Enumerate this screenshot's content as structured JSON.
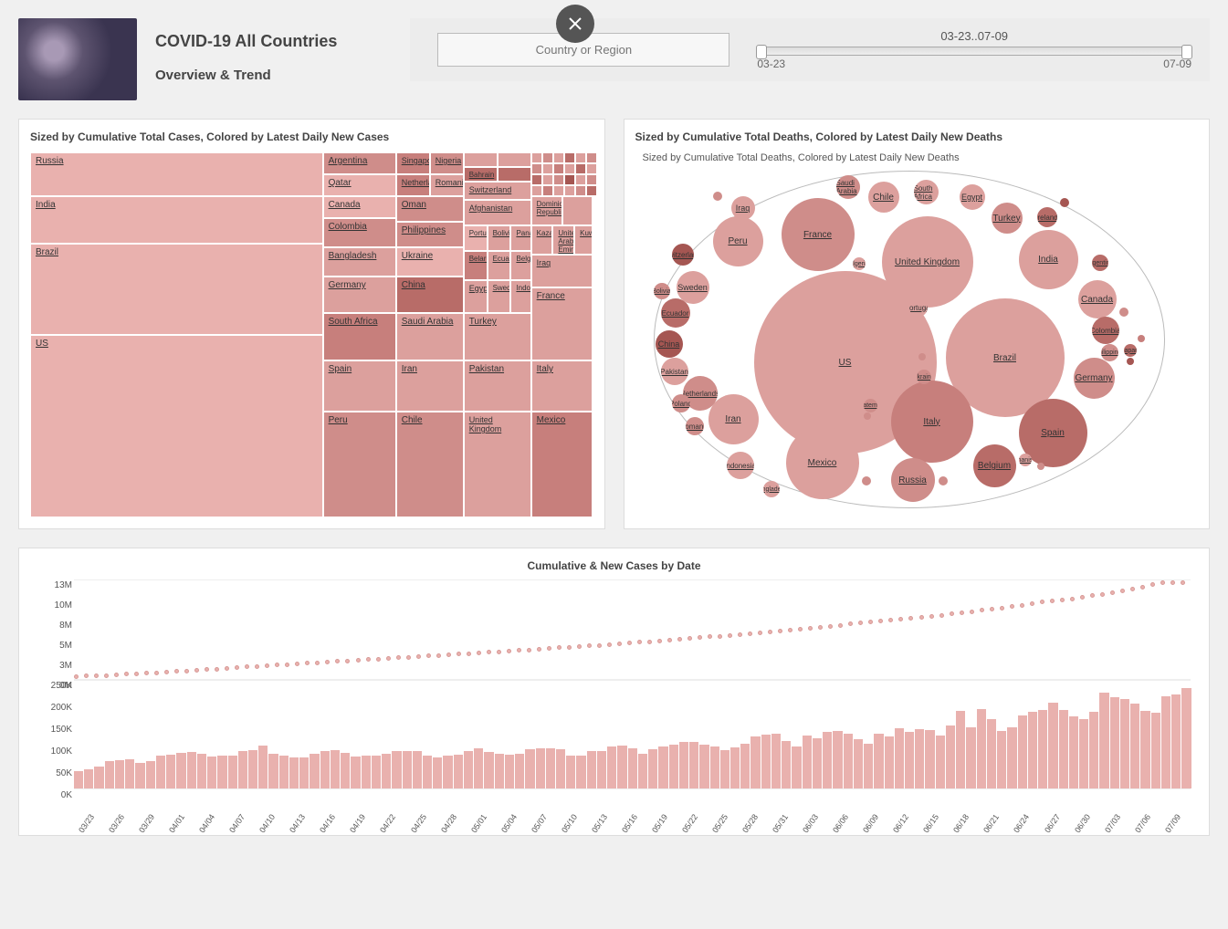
{
  "header": {
    "title": "COVID-19 All Countries",
    "subtitle": "Overview & Trend"
  },
  "filter": {
    "placeholder": "Country or Region",
    "range_label": "03-23..07-09",
    "range_start": "03-23",
    "range_end": "07-09"
  },
  "treemap_panel": {
    "title": "Sized by Cumulative Total Cases, Colored by Latest Daily New Cases"
  },
  "bubble_panel": {
    "title": "Sized by Cumulative Total Deaths, Colored by Latest Daily New Deaths",
    "subtitle": "Sized by Cumulative Total Deaths, Colored by Latest Daily New Deaths"
  },
  "bottom_panel": {
    "title": "Cumulative & New Cases by Date"
  },
  "chart_data": [
    {
      "type": "treemap",
      "title": "Sized by Cumulative Total Cases, Colored by Latest Daily New Cases",
      "items": [
        {
          "name": "US",
          "size": 3200000,
          "color": 1
        },
        {
          "name": "Brazil",
          "size": 1800000,
          "color": 1
        },
        {
          "name": "India",
          "size": 800000,
          "color": 1
        },
        {
          "name": "Russia",
          "size": 700000,
          "color": 1
        },
        {
          "name": "Peru",
          "size": 320000,
          "color": 3
        },
        {
          "name": "Spain",
          "size": 300000,
          "color": 2
        },
        {
          "name": "Chile",
          "size": 300000,
          "color": 3
        },
        {
          "name": "United Kingdom",
          "size": 290000,
          "color": 2
        },
        {
          "name": "Mexico",
          "size": 280000,
          "color": 4
        },
        {
          "name": "South Africa",
          "size": 250000,
          "color": 4
        },
        {
          "name": "Iran",
          "size": 250000,
          "color": 2
        },
        {
          "name": "Pakistan",
          "size": 240000,
          "color": 2
        },
        {
          "name": "Italy",
          "size": 240000,
          "color": 2
        },
        {
          "name": "Saudi Arabia",
          "size": 230000,
          "color": 2
        },
        {
          "name": "Turkey",
          "size": 210000,
          "color": 2
        },
        {
          "name": "France",
          "size": 210000,
          "color": 2
        },
        {
          "name": "Germany",
          "size": 200000,
          "color": 2
        },
        {
          "name": "Bangladesh",
          "size": 180000,
          "color": 2
        },
        {
          "name": "Colombia",
          "size": 140000,
          "color": 3
        },
        {
          "name": "Canada",
          "size": 110000,
          "color": 1
        },
        {
          "name": "Qatar",
          "size": 100000,
          "color": 1
        },
        {
          "name": "Argentina",
          "size": 90000,
          "color": 3
        },
        {
          "name": "China",
          "size": 85000,
          "color": 5
        },
        {
          "name": "Egypt",
          "size": 80000,
          "color": 2
        },
        {
          "name": "Sweden",
          "size": 75000,
          "color": 2
        },
        {
          "name": "Indonesia",
          "size": 70000,
          "color": 2
        },
        {
          "name": "Iraq",
          "size": 70000,
          "color": 2
        },
        {
          "name": "Belarus",
          "size": 65000,
          "color": 4
        },
        {
          "name": "Ecuador",
          "size": 65000,
          "color": 2
        },
        {
          "name": "Belgium",
          "size": 62000,
          "color": 2
        },
        {
          "name": "Kazakhstan",
          "size": 55000,
          "color": 2
        },
        {
          "name": "United Arab Emirates",
          "size": 54000,
          "color": 2
        },
        {
          "name": "Kuwait",
          "size": 53000,
          "color": 2
        },
        {
          "name": "Ukraine",
          "size": 52000,
          "color": 1
        },
        {
          "name": "Oman",
          "size": 51000,
          "color": 3
        },
        {
          "name": "Philippines",
          "size": 50000,
          "color": 3
        },
        {
          "name": "Portugal",
          "size": 45000,
          "color": 1
        },
        {
          "name": "Bolivia",
          "size": 44000,
          "color": 2
        },
        {
          "name": "Panama",
          "size": 42000,
          "color": 2
        },
        {
          "name": "Dominican Republic",
          "size": 41000,
          "color": 2
        },
        {
          "name": "Afghanistan",
          "size": 34000,
          "color": 2
        },
        {
          "name": "Switzerland",
          "size": 33000,
          "color": 2
        },
        {
          "name": "Netherlands",
          "size": 51000,
          "color": 4
        },
        {
          "name": "Singapore",
          "size": 45000,
          "color": 4
        },
        {
          "name": "Nigeria",
          "size": 31000,
          "color": 3
        },
        {
          "name": "Romania",
          "size": 31000,
          "color": 2
        },
        {
          "name": "Bahrain",
          "size": 31000,
          "color": 5
        }
      ]
    },
    {
      "type": "bubble",
      "title": "Sized by Cumulative Total Deaths, Colored by Latest Daily New Deaths",
      "items": [
        {
          "name": "US",
          "size": 135000,
          "color": 2
        },
        {
          "name": "Brazil",
          "size": 70000,
          "color": 2
        },
        {
          "name": "United Kingdom",
          "size": 45000,
          "color": 2
        },
        {
          "name": "Italy",
          "size": 35000,
          "color": 4
        },
        {
          "name": "Mexico",
          "size": 34000,
          "color": 2
        },
        {
          "name": "France",
          "size": 30000,
          "color": 3
        },
        {
          "name": "Spain",
          "size": 28000,
          "color": 5
        },
        {
          "name": "India",
          "size": 22000,
          "color": 2
        },
        {
          "name": "Iran",
          "size": 13000,
          "color": 2
        },
        {
          "name": "Peru",
          "size": 12000,
          "color": 2
        },
        {
          "name": "Russia",
          "size": 11000,
          "color": 3
        },
        {
          "name": "Belgium",
          "size": 10000,
          "color": 5
        },
        {
          "name": "Germany",
          "size": 9000,
          "color": 3
        },
        {
          "name": "Canada",
          "size": 8800,
          "color": 2
        },
        {
          "name": "Netherlands",
          "size": 6100,
          "color": 3
        },
        {
          "name": "Chile",
          "size": 7000,
          "color": 2
        },
        {
          "name": "Sweden",
          "size": 5500,
          "color": 2
        },
        {
          "name": "Turkey",
          "size": 5300,
          "color": 3
        },
        {
          "name": "Ecuador",
          "size": 5000,
          "color": 5
        },
        {
          "name": "China",
          "size": 4600,
          "color": 6
        },
        {
          "name": "Colombia",
          "size": 4600,
          "color": 5
        },
        {
          "name": "Indonesia",
          "size": 3500,
          "color": 2
        },
        {
          "name": "Pakistan",
          "size": 5000,
          "color": 2
        },
        {
          "name": "Egypt",
          "size": 3900,
          "color": 2
        },
        {
          "name": "South Africa",
          "size": 3700,
          "color": 2
        },
        {
          "name": "Iraq",
          "size": 3000,
          "color": 2
        },
        {
          "name": "Saudi Arabia",
          "size": 2000,
          "color": 3
        },
        {
          "name": "Switzerland",
          "size": 1900,
          "color": 6
        },
        {
          "name": "Ireland",
          "size": 1700,
          "color": 5
        },
        {
          "name": "Portugal",
          "size": 1600,
          "color": 2
        },
        {
          "name": "Poland",
          "size": 1500,
          "color": 3
        },
        {
          "name": "Romania",
          "size": 1800,
          "color": 3
        },
        {
          "name": "Philippines",
          "size": 1300,
          "color": 3
        },
        {
          "name": "Argentina",
          "size": 1700,
          "color": 5
        },
        {
          "name": "Bolivia",
          "size": 1500,
          "color": 3
        },
        {
          "name": "Ukraine",
          "size": 1300,
          "color": 3
        },
        {
          "name": "Bangladesh",
          "size": 2300,
          "color": 2
        },
        {
          "name": "Guatemala",
          "size": 1100,
          "color": 3
        },
        {
          "name": "Algeria",
          "size": 1000,
          "color": 2
        },
        {
          "name": "Afghanistan",
          "size": 1000,
          "color": 2
        },
        {
          "name": "Japan",
          "size": 980,
          "color": 5
        }
      ]
    },
    {
      "type": "line",
      "title": "Cumulative Cases",
      "xlabel": "",
      "ylabel": "",
      "ylim": [
        0,
        13000000
      ],
      "y_ticks": [
        "0M",
        "3M",
        "5M",
        "8M",
        "10M",
        "13M"
      ],
      "x": [
        "03/23",
        "03/26",
        "03/29",
        "04/01",
        "04/04",
        "04/07",
        "04/10",
        "04/13",
        "04/16",
        "04/19",
        "04/22",
        "04/25",
        "04/28",
        "05/01",
        "05/04",
        "05/07",
        "05/10",
        "05/13",
        "05/16",
        "05/19",
        "05/22",
        "05/25",
        "05/28",
        "05/31",
        "06/03",
        "06/06",
        "06/09",
        "06/12",
        "06/15",
        "06/18",
        "06/21",
        "06/24",
        "06/27",
        "06/30",
        "07/03",
        "07/06",
        "07/09"
      ],
      "values": [
        380000,
        530000,
        720000,
        940000,
        1200000,
        1430000,
        1690000,
        1920000,
        2160000,
        2400000,
        2630000,
        2880000,
        3100000,
        3350000,
        3580000,
        3840000,
        4100000,
        4340000,
        4620000,
        4900000,
        5210000,
        5500000,
        5820000,
        6170000,
        6510000,
        6910000,
        7280000,
        7640000,
        8040000,
        8470000,
        8930000,
        9440000,
        9990000,
        10450000,
        11050000,
        11670000,
        12550000
      ]
    },
    {
      "type": "bar",
      "title": "New Cases",
      "xlabel": "",
      "ylabel": "",
      "ylim": [
        0,
        250000
      ],
      "y_ticks": [
        "0K",
        "50K",
        "100K",
        "150K",
        "200K",
        "250K"
      ],
      "categories": [
        "03/23",
        "03/24",
        "03/25",
        "03/26",
        "03/27",
        "03/28",
        "03/29",
        "03/30",
        "03/31",
        "04/01",
        "04/02",
        "04/03",
        "04/04",
        "04/05",
        "04/06",
        "04/07",
        "04/08",
        "04/09",
        "04/10",
        "04/11",
        "04/12",
        "04/13",
        "04/14",
        "04/15",
        "04/16",
        "04/17",
        "04/18",
        "04/19",
        "04/20",
        "04/21",
        "04/22",
        "04/23",
        "04/24",
        "04/25",
        "04/26",
        "04/27",
        "04/28",
        "04/29",
        "04/30",
        "05/01",
        "05/02",
        "05/03",
        "05/04",
        "05/05",
        "05/06",
        "05/07",
        "05/08",
        "05/09",
        "05/10",
        "05/11",
        "05/12",
        "05/13",
        "05/14",
        "05/15",
        "05/16",
        "05/17",
        "05/18",
        "05/19",
        "05/20",
        "05/21",
        "05/22",
        "05/23",
        "05/24",
        "05/25",
        "05/26",
        "05/27",
        "05/28",
        "05/29",
        "05/30",
        "05/31",
        "06/01",
        "06/02",
        "06/03",
        "06/04",
        "06/05",
        "06/06",
        "06/07",
        "06/08",
        "06/09",
        "06/10",
        "06/11",
        "06/12",
        "06/13",
        "06/14",
        "06/15",
        "06/16",
        "06/17",
        "06/18",
        "06/19",
        "06/20",
        "06/21",
        "06/22",
        "06/23",
        "06/24",
        "06/25",
        "06/26",
        "06/27",
        "06/28",
        "06/29",
        "06/30",
        "07/01",
        "07/02",
        "07/03",
        "07/04",
        "07/05",
        "07/06",
        "07/07",
        "07/08",
        "07/09"
      ],
      "values": [
        40000,
        43000,
        50000,
        62000,
        65000,
        67000,
        59000,
        63000,
        76000,
        77000,
        81000,
        83000,
        80000,
        73000,
        74000,
        75000,
        85000,
        87000,
        97000,
        80000,
        74000,
        71000,
        70000,
        80000,
        85000,
        88000,
        81000,
        73000,
        76000,
        76000,
        80000,
        85000,
        86000,
        85000,
        74000,
        70000,
        76000,
        78000,
        85000,
        91000,
        83000,
        79000,
        78000,
        80000,
        90000,
        91000,
        92000,
        89000,
        76000,
        75000,
        85000,
        86000,
        95000,
        97000,
        92000,
        79000,
        90000,
        95000,
        99000,
        107000,
        107000,
        100000,
        95000,
        87000,
        93000,
        103000,
        118000,
        122000,
        126000,
        108000,
        96000,
        121000,
        115000,
        130000,
        132000,
        126000,
        112000,
        103000,
        125000,
        119000,
        138000,
        129000,
        135000,
        134000,
        120000,
        143000,
        178000,
        140000,
        181000,
        158000,
        131000,
        139000,
        167000,
        175000,
        180000,
        195000,
        179000,
        165000,
        158000,
        175000,
        218000,
        208000,
        205000,
        193000,
        178000,
        173000,
        211000,
        214000,
        229000
      ]
    }
  ]
}
